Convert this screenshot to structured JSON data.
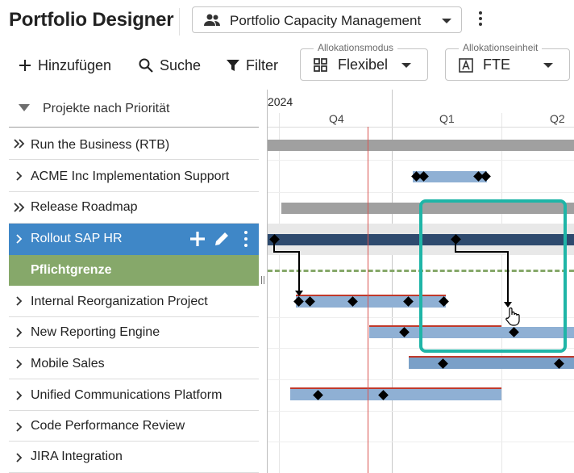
{
  "header": {
    "app_title": "Portfolio Designer",
    "portfolio_select": "Portfolio Capacity Management"
  },
  "toolbar": {
    "add_label": "Hinzufügen",
    "search_label": "Suche",
    "filter_label": "Filter",
    "allocation_mode": {
      "label": "Allokationsmodus",
      "value": "Flexibel"
    },
    "allocation_unit": {
      "label": "Allokationseinheit",
      "value": "FTE"
    }
  },
  "list": {
    "group_header": "Projekte nach Priorität",
    "rows": [
      {
        "label": "Run the Business (RTB)",
        "chevron": "double"
      },
      {
        "label": "ACME Inc Implementation Support",
        "chevron": "single"
      },
      {
        "label": "Release Roadmap",
        "chevron": "double"
      },
      {
        "label": "Rollout SAP HR",
        "chevron": "single",
        "selected": true
      },
      {
        "label": "Pflichtgrenze",
        "chevron": "none"
      },
      {
        "label": "Internal Reorganization Project",
        "chevron": "single"
      },
      {
        "label": "New Reporting Engine",
        "chevron": "single"
      },
      {
        "label": "Mobile Sales",
        "chevron": "single"
      },
      {
        "label": "Unified Communications Platform",
        "chevron": "single"
      },
      {
        "label": "Code Performance Review",
        "chevron": "single"
      },
      {
        "label": "JIRA Integration",
        "chevron": "single"
      }
    ]
  },
  "timeline": {
    "year": "2024",
    "quarters": [
      "Q4",
      "Q1",
      "Q2"
    ]
  },
  "colors": {
    "selected_row": "#3f87c7",
    "mandatory_row": "#86a86a",
    "highlight_box": "#1fb5a7",
    "today_line": "#d9534f"
  }
}
